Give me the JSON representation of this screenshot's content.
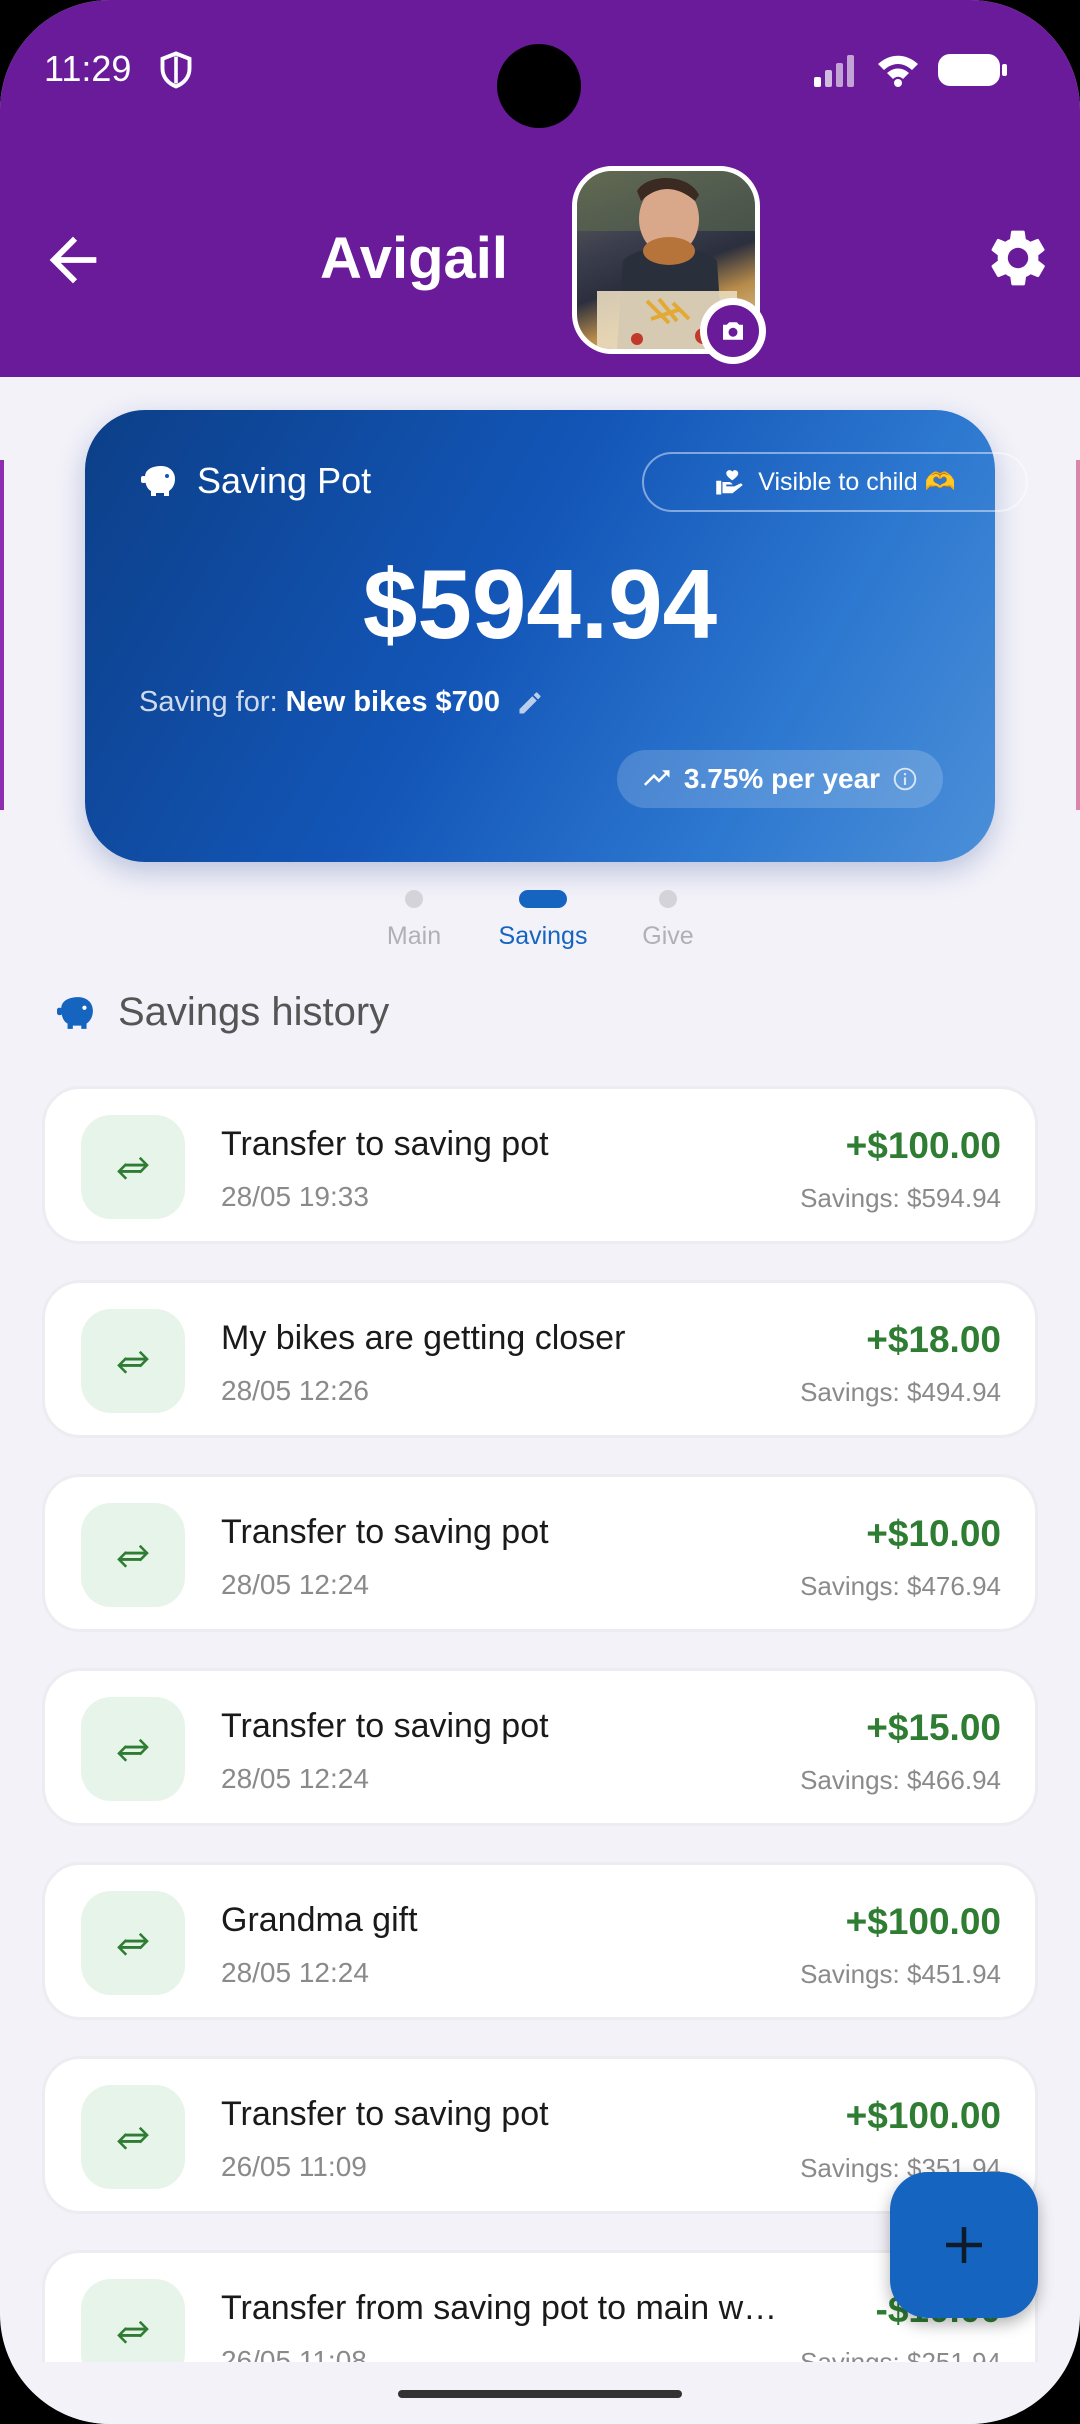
{
  "status": {
    "time": "11:29"
  },
  "header": {
    "title": "Avigail"
  },
  "card": {
    "title": "Saving Pot",
    "visible_label": "Visible to child 🫶",
    "balance": "$594.94",
    "saving_for_label": "Saving for:",
    "saving_for_goal": "New bikes $700",
    "rate": "3.75% per year"
  },
  "tabs": [
    {
      "label": "Main"
    },
    {
      "label": "Savings"
    },
    {
      "label": "Give"
    }
  ],
  "section": {
    "title": "Savings history"
  },
  "transactions": [
    {
      "title": "Transfer to saving pot",
      "date": "28/05  19:33",
      "amount": "+$100.00",
      "savings": "Savings: $594.94"
    },
    {
      "title": "My bikes are getting closer",
      "date": "28/05  12:26",
      "amount": "+$18.00",
      "savings": "Savings: $494.94"
    },
    {
      "title": "Transfer to saving pot",
      "date": "28/05  12:24",
      "amount": "+$10.00",
      "savings": "Savings: $476.94"
    },
    {
      "title": "Transfer to saving pot",
      "date": "28/05  12:24",
      "amount": "+$15.00",
      "savings": "Savings: $466.94"
    },
    {
      "title": "Grandma gift",
      "date": "28/05  12:24",
      "amount": "+$100.00",
      "savings": "Savings: $451.94"
    },
    {
      "title": "Transfer to saving pot",
      "date": "26/05  11:09",
      "amount": "+$100.00",
      "savings": "Savings: $351.94"
    },
    {
      "title": "Transfer from saving pot to main wallet",
      "date": "26/05  11:08",
      "amount": "-$10.00",
      "savings": "Savings: $251.94"
    }
  ],
  "colors": {
    "header": "#6a1b9a",
    "accent": "#1565c0",
    "positive": "#2e7d32"
  }
}
